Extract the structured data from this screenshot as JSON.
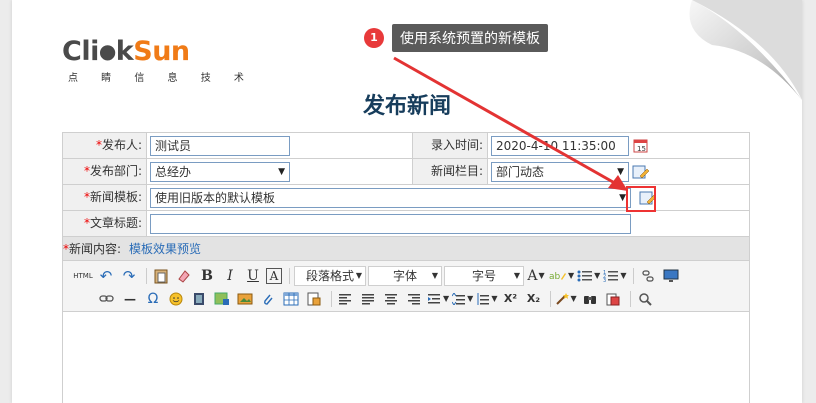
{
  "logo": {
    "part_a": "Cli",
    "part_dot": "●",
    "part_b": "k",
    "part_c": "Sun",
    "subtitle": "点 睛 信 息 技 术"
  },
  "page_title": "发布新闻",
  "callout": {
    "number": "1",
    "text": "使用系统预置的新模板"
  },
  "form": {
    "publisher": {
      "label": "发布人:",
      "value": "测试员"
    },
    "entry_time": {
      "label": "录入时间:",
      "value": "2020-4-10 11:35:00"
    },
    "department": {
      "label": "发布部门:",
      "value": "总经办"
    },
    "column": {
      "label": "新闻栏目:",
      "value": "部门动态"
    },
    "template": {
      "label": "新闻模板:",
      "value": "使用旧版本的默认模板"
    },
    "article_title": {
      "label": "文章标题:",
      "value": ""
    },
    "content": {
      "label": "新闻内容:",
      "preview_link": "模板效果预览"
    }
  },
  "toolbar": {
    "html": "HTML",
    "undo": "↶",
    "redo": "↷",
    "bold": "B",
    "italic": "I",
    "underline": "U",
    "font_border": "A",
    "paragraph": "段落格式",
    "font": "字体",
    "size": "字号",
    "font_color": "A",
    "omega": "Ω",
    "hr": "—",
    "superscript": "X²",
    "subscript": "X₂"
  },
  "colors": {
    "accent_red": "#e33333",
    "title_blue": "#173d5c",
    "logo_orange": "#f07b17",
    "link_blue": "#2a6cb7"
  }
}
